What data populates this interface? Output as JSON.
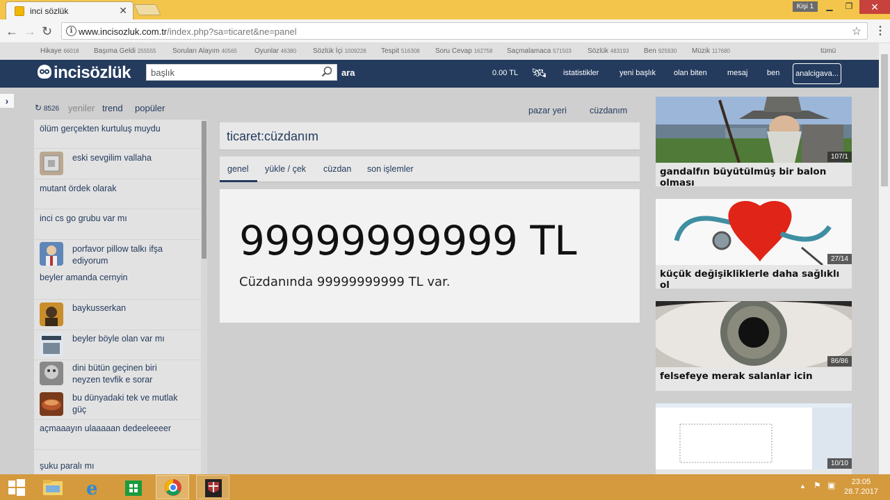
{
  "browser": {
    "tab_title": "inci sözlük",
    "profile": "Kişi 1",
    "url_domain": "www.incisozluk.com.tr",
    "url_path": "/index.php?sa=ticaret&ne=panel"
  },
  "categories": [
    {
      "name": "Hikaye",
      "count": "66018"
    },
    {
      "name": "Başıma Geldi",
      "count": "255555"
    },
    {
      "name": "Soruları Alayım",
      "count": "40565"
    },
    {
      "name": "Oyunlar",
      "count": "46380"
    },
    {
      "name": "Sözlük İçi",
      "count": "1009228"
    },
    {
      "name": "Tespit",
      "count": "516308"
    },
    {
      "name": "Soru Cevap",
      "count": "162758"
    },
    {
      "name": "Saçmalamaca",
      "count": "571503"
    },
    {
      "name": "Sözlük",
      "count": "483193"
    },
    {
      "name": "Ben",
      "count": "925930"
    },
    {
      "name": "Müzik",
      "count": "117680"
    }
  ],
  "categories_all": "tümü",
  "header": {
    "logo": "incisözlük",
    "search_value": "başlık",
    "search_button": "ara",
    "balance": "0.00 TL",
    "links": [
      "istatistikler",
      "yeni başlık",
      "olan biten",
      "mesaj",
      "ben"
    ],
    "user": "analcigava..."
  },
  "left": {
    "count": "8526",
    "tabs": [
      "yeniler",
      "trend",
      "popüler"
    ],
    "items": [
      "ölüm gerçekten kurtuluş muydu",
      "eski sevgilim vallaha",
      "mutant ördek olarak",
      "inci cs go grubu var mı",
      "porfavor pillow talkı ifşa ediyorum",
      "beyler amanda cernyin",
      "baykusserkan",
      "beyler böyle olan var mı",
      "dini bütün geçinen biri neyzen tevfik e sorar",
      "bu dünyadaki tek ve mutlak güç",
      "açmaaayın ulaaaaan dedeeleeeer",
      "şuku paralı mı"
    ]
  },
  "center": {
    "top_links": [
      "pazar yeri",
      "cüzdanım"
    ],
    "title": "ticaret:cüzdanım",
    "tabs": [
      "genel",
      "yükle / çek",
      "cüzdan",
      "son işlemler"
    ],
    "big_value": "99999999999 TL",
    "sentence": "Cüzdanında 99999999999 TL var."
  },
  "right": [
    {
      "caption": "gandalfın büyütülmüş bir balon olması",
      "badge": "107/1"
    },
    {
      "caption": "küçük değişikliklerle daha sağlıklı ol",
      "badge": "27/14"
    },
    {
      "caption": "felsefeye merak salanlar icin",
      "badge": "86/86"
    },
    {
      "caption": "",
      "badge": "10/10"
    }
  ],
  "taskbar": {
    "time": "23:05",
    "date": "28.7.2017"
  }
}
